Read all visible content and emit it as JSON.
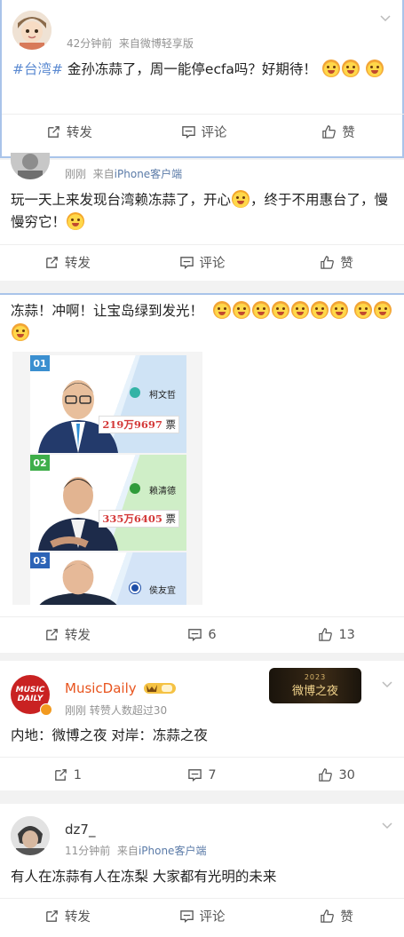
{
  "posts": [
    {
      "time": "42分钟前",
      "source": "来自微博轻享版",
      "topic": "#台湾#",
      "text": " 金孙冻蒜了，周一能停ecfa吗？好期待！",
      "actions": {
        "repost": "转发",
        "comment": "评论",
        "like": "赞"
      }
    },
    {
      "time": "刚刚",
      "source_prefix": "来自",
      "source_link": "iPhone客户端",
      "text_a": "玩一天上来发现台湾赖冻蒜了，开心",
      "text_b": "，终于不用惠台了，慢慢穷它！",
      "actions": {
        "repost": "转发",
        "comment": "评论",
        "like": "赞"
      }
    },
    {
      "text": "冻蒜！冲啊！让宝岛绿到发光！",
      "candidates": [
        {
          "num": "01",
          "name": "柯文哲",
          "votes": "219万9697",
          "unit": "票"
        },
        {
          "num": "02",
          "name": "赖清德",
          "votes": "335万6405",
          "unit": "票"
        },
        {
          "num": "03",
          "name": "侯友宜"
        }
      ],
      "actions": {
        "repost": "转发",
        "comment": "6",
        "like": "13"
      }
    },
    {
      "name": "MusicDaily",
      "avatar_text": "MUSIC DAILY",
      "time": "刚刚",
      "source": "转赞人数超过30",
      "banner_year": "2023",
      "banner_title": "微博之夜",
      "text": "内地：微博之夜 对岸：冻蒜之夜",
      "actions": {
        "repost": "1",
        "comment": "7",
        "like": "30"
      }
    },
    {
      "name": "dz7_",
      "time": "11分钟前",
      "source_prefix": "来自",
      "source_link": "iPhone客户端",
      "text": "有人在冻蒜有人在冻梨 大家都有光明的未来",
      "actions": {
        "repost": "转发",
        "comment": "评论",
        "like": "赞"
      }
    }
  ],
  "colors": {
    "topic": "#5b8ad1",
    "meta": "#939393",
    "link": "#5b7ba8",
    "name_vip": "#e8541e"
  }
}
